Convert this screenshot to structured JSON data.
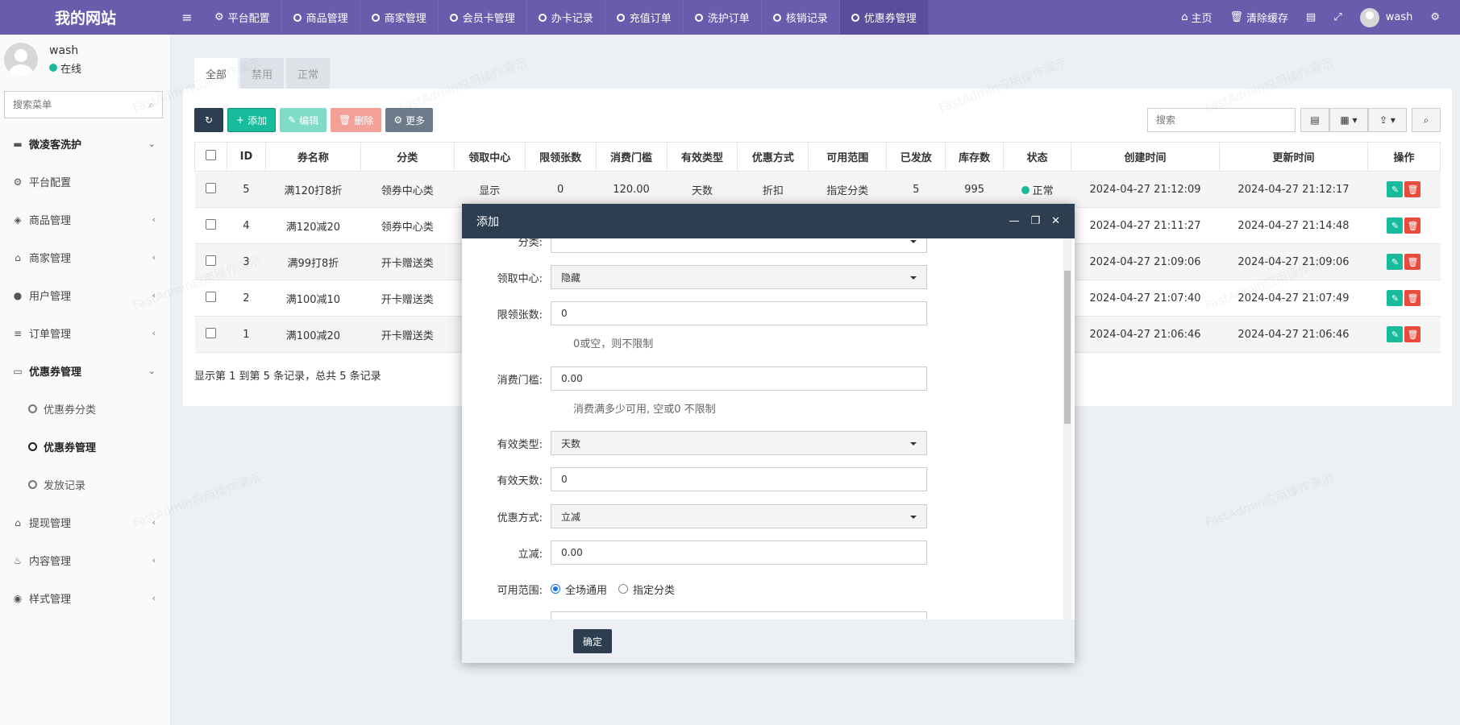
{
  "app": {
    "logo": "我的网站",
    "top_nav": [
      {
        "label": "平台配置",
        "icon": "gear-icon",
        "active": false
      },
      {
        "label": "商品管理",
        "icon": "ring-icon",
        "active": false
      },
      {
        "label": "商家管理",
        "icon": "ring-icon",
        "active": false
      },
      {
        "label": "会员卡管理",
        "icon": "ring-icon",
        "active": false
      },
      {
        "label": "办卡记录",
        "icon": "ring-icon",
        "active": false
      },
      {
        "label": "充值订单",
        "icon": "ring-icon",
        "active": false
      },
      {
        "label": "洗护订单",
        "icon": "ring-icon",
        "active": false
      },
      {
        "label": "核销记录",
        "icon": "ring-icon",
        "active": false
      },
      {
        "label": "优惠券管理",
        "icon": "ring-icon",
        "active": true
      }
    ],
    "top_right": {
      "home": "主页",
      "clear_cache": "清除缓存",
      "username": "wash"
    }
  },
  "sidebar": {
    "user": {
      "name": "wash",
      "status": "在线"
    },
    "search_placeholder": "搜索菜单",
    "groups": [
      {
        "label": "微凌客洗护",
        "icon": "folder-icon",
        "bold": true,
        "arrow": "⌄"
      },
      {
        "label": "平台配置",
        "icon": "gear-icon",
        "arrow": ""
      },
      {
        "label": "商品管理",
        "icon": "cube-icon",
        "arrow": "‹"
      },
      {
        "label": "商家管理",
        "icon": "bank-icon",
        "arrow": "‹"
      },
      {
        "label": "用户管理",
        "icon": "user-icon",
        "arrow": "‹"
      },
      {
        "label": "订单管理",
        "icon": "list-icon",
        "arrow": "‹"
      },
      {
        "label": "优惠券管理",
        "icon": "ticket-icon",
        "bold": true,
        "arrow": "⌄"
      }
    ],
    "coupon_sub": [
      {
        "label": "优惠券分类",
        "active": false
      },
      {
        "label": "优惠券管理",
        "active": true
      },
      {
        "label": "发放记录",
        "active": false
      }
    ],
    "groups_bottom": [
      {
        "label": "提现管理",
        "icon": "bank-icon",
        "arrow": "‹"
      },
      {
        "label": "内容管理",
        "icon": "content-icon",
        "arrow": "‹"
      },
      {
        "label": "样式管理",
        "icon": "palette-icon",
        "arrow": "‹"
      }
    ]
  },
  "tabs": [
    "全部",
    "禁用",
    "正常"
  ],
  "toolbar": {
    "add": "添加",
    "edit": "编辑",
    "delete": "删除",
    "more": "更多",
    "search_placeholder": "搜索"
  },
  "table": {
    "columns": [
      "ID",
      "券名称",
      "分类",
      "领取中心",
      "限领张数",
      "消费门槛",
      "有效类型",
      "优惠方式",
      "可用范围",
      "已发放",
      "库存数",
      "状态",
      "创建时间",
      "更新时间",
      "操作"
    ],
    "rows": [
      {
        "id": "5",
        "name": "满120打8折",
        "category": "领券中心类",
        "center": "显示",
        "limit": "0",
        "threshold": "120.00",
        "valid_type": "天数",
        "discount": "折扣",
        "scope": "指定分类",
        "issued": "5",
        "stock": "995",
        "status": "正常",
        "created": "2024-04-27 21:12:09",
        "updated": "2024-04-27 21:12:17"
      },
      {
        "id": "4",
        "name": "满120减20",
        "category": "领券中心类",
        "created": "2024-04-27 21:11:27",
        "updated": "2024-04-27 21:14:48"
      },
      {
        "id": "3",
        "name": "满99打8折",
        "category": "开卡赠送类",
        "created": "2024-04-27 21:09:06",
        "updated": "2024-04-27 21:09:06"
      },
      {
        "id": "2",
        "name": "满100减10",
        "category": "开卡赠送类",
        "created": "2024-04-27 21:07:40",
        "updated": "2024-04-27 21:07:49"
      },
      {
        "id": "1",
        "name": "满100减20",
        "category": "开卡赠送类",
        "created": "2024-04-27 21:06:46",
        "updated": "2024-04-27 21:06:46"
      }
    ],
    "page_info": "显示第 1 到第 5 条记录，总共 5 条记录"
  },
  "modal": {
    "title": "添加",
    "fields": {
      "category_label": "分类:",
      "category_value": "",
      "center_label": "领取中心:",
      "center_value": "隐藏",
      "limit_label": "限领张数:",
      "limit_value": "0",
      "limit_help": "0或空，则不限制",
      "threshold_label": "消费门槛:",
      "threshold_value": "0.00",
      "threshold_help": "消费满多少可用, 空或0 不限制",
      "valid_type_label": "有效类型:",
      "valid_type_value": "天数",
      "valid_days_label": "有效天数:",
      "valid_days_value": "0",
      "discount_label": "优惠方式:",
      "discount_value": "立减",
      "reduce_label": "立减:",
      "reduce_value": "0.00",
      "scope_label": "可用范围:",
      "scope_opt1": "全场通用",
      "scope_opt2": "指定分类"
    },
    "confirm": "确定"
  },
  "watermark": "FastAdmin应用操作演示"
}
